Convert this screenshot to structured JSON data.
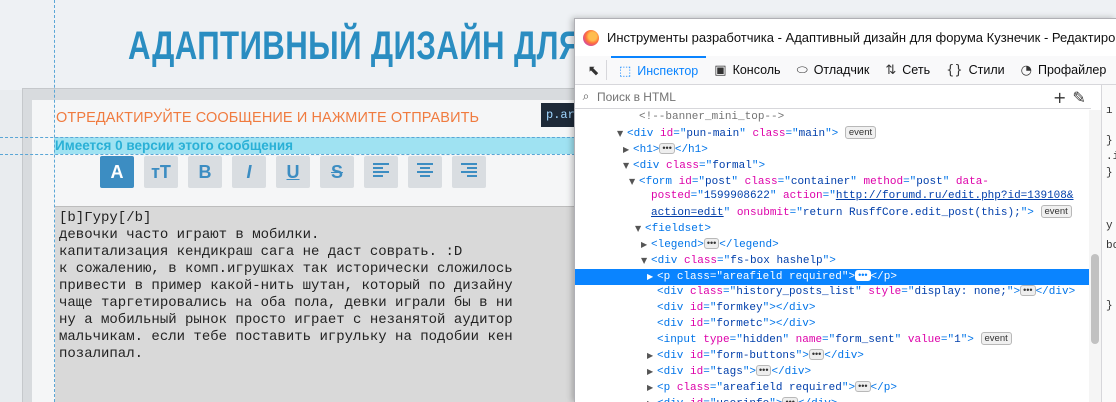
{
  "page": {
    "site_title": "АДАПТИВНЫЙ ДИЗАЙН ДЛЯ ФОРУМА",
    "edit_heading": "ОТРЕДАКТИРУЙТЕ СООБЩЕНИЕ И НАЖМИТЕ ОТПРАВИТЬ",
    "tooltip_chip": "p.areafield",
    "versions_text": "Имеется 0 версии этого сообщения",
    "toolbar": [
      {
        "name": "font-size-icon",
        "glyph": "A",
        "active": true
      },
      {
        "name": "text-case-icon",
        "glyph": "тT",
        "active": false
      },
      {
        "name": "bold-icon",
        "glyph": "B",
        "active": false
      },
      {
        "name": "italic-icon",
        "glyph": "I",
        "active": false
      },
      {
        "name": "underline-icon",
        "glyph": "U",
        "active": false
      },
      {
        "name": "strikethrough-icon",
        "glyph": "S",
        "active": false
      },
      {
        "name": "align-left-icon",
        "glyph": "",
        "active": false
      },
      {
        "name": "align-center-icon",
        "glyph": "",
        "active": false
      },
      {
        "name": "align-right-icon",
        "glyph": "",
        "active": false
      }
    ],
    "message_text": "[b]Гуру[/b]\nдевочки часто играют в мобилки.\nкапитализация кендикраш сага не даст соврать. :D\nк сожалению, в комп.игрушках так исторически сложилось\nпривести в пример какой-нить шутан, который по дизайну\nчаще таргетировались на оба пола, девки играли бы в ни\nну а мобильный рынок просто играет с незанятой аудитор\nмальчикам. если тебе поставить игрульку на подобии кен\nпозалипал."
  },
  "devtools": {
    "window_title": "Инструменты разработчика - Адаптивный дизайн для форума Кузнечик - Редактирование со",
    "tabs": [
      {
        "icon": "inspector-icon",
        "glyph": "⬚",
        "label": "Инспектор",
        "selected": true
      },
      {
        "icon": "console-icon",
        "glyph": "▣",
        "label": "Консоль",
        "selected": false
      },
      {
        "icon": "debugger-icon",
        "glyph": "⬭",
        "label": "Отладчик",
        "selected": false
      },
      {
        "icon": "network-icon",
        "glyph": "⇅",
        "label": "Сеть",
        "selected": false
      },
      {
        "icon": "style-editor-icon",
        "glyph": "{}",
        "label": "Стили",
        "selected": false
      },
      {
        "icon": "profiler-icon",
        "glyph": "◔",
        "label": "Профайлер",
        "selected": false
      }
    ],
    "search_placeholder": "Поиск в HTML",
    "side_pane_chars": [
      "ı",
      "}",
      ".i",
      "}",
      "у",
      "bo",
      "}"
    ],
    "selected_row": 9,
    "tree": [
      {
        "indent": 10,
        "tw": "",
        "parts": [
          [
            "cm",
            "<!--banner_mini_top-->"
          ]
        ]
      },
      {
        "indent": 8,
        "tw": "▼",
        "parts": [
          [
            "t",
            "<div "
          ],
          [
            "an",
            "id"
          ],
          [
            "t",
            "=\""
          ],
          [
            "av",
            "pun-main"
          ],
          [
            "t",
            "\" "
          ],
          [
            "an",
            "class"
          ],
          [
            "t",
            "=\""
          ],
          [
            "av",
            "main"
          ],
          [
            "t",
            "\">"
          ]
        ],
        "badge": "event"
      },
      {
        "indent": 9,
        "tw": "▶",
        "parts": [
          [
            "t",
            "<h1>"
          ]
        ],
        "ell": true,
        "after": [
          [
            "t",
            "</h1>"
          ]
        ]
      },
      {
        "indent": 9,
        "tw": "▼",
        "parts": [
          [
            "t",
            "<div "
          ],
          [
            "an",
            "class"
          ],
          [
            "t",
            "=\""
          ],
          [
            "av",
            "formal"
          ],
          [
            "t",
            "\">"
          ]
        ]
      },
      {
        "indent": 10,
        "tw": "▼",
        "parts": [
          [
            "t",
            "<form "
          ],
          [
            "an",
            "id"
          ],
          [
            "t",
            "=\""
          ],
          [
            "av",
            "post"
          ],
          [
            "t",
            "\" "
          ],
          [
            "an",
            "class"
          ],
          [
            "t",
            "=\""
          ],
          [
            "av",
            "container"
          ],
          [
            "t",
            "\" "
          ],
          [
            "an",
            "method"
          ],
          [
            "t",
            "=\""
          ],
          [
            "av",
            "post"
          ],
          [
            "t",
            "\" "
          ],
          [
            "an",
            "data-"
          ]
        ]
      },
      {
        "indent": 12,
        "tw": "",
        "parts": [
          [
            "an",
            "posted"
          ],
          [
            "t",
            "=\""
          ],
          [
            "av",
            "1599908622"
          ],
          [
            "t",
            "\" "
          ],
          [
            "an",
            "action"
          ],
          [
            "t",
            "=\""
          ],
          [
            "av link",
            "http://forumd.ru/edit.php?id=139108&"
          ]
        ]
      },
      {
        "indent": 12,
        "tw": "",
        "parts": [
          [
            "av link",
            "action=edit"
          ],
          [
            "t",
            "\" "
          ],
          [
            "an",
            "onsubmit"
          ],
          [
            "t",
            "=\""
          ],
          [
            "av",
            "return RusffCore.edit_post(this);"
          ],
          [
            "t",
            "\">"
          ]
        ],
        "badge": "event"
      },
      {
        "indent": 11,
        "tw": "▼",
        "parts": [
          [
            "t",
            "<fieldset>"
          ]
        ]
      },
      {
        "indent": 12,
        "tw": "▶",
        "parts": [
          [
            "t",
            "<legend>"
          ]
        ],
        "ell": true,
        "after": [
          [
            "t",
            "</legend>"
          ]
        ]
      },
      {
        "indent": 12,
        "tw": "▼",
        "parts": [
          [
            "t",
            "<div "
          ],
          [
            "an",
            "class"
          ],
          [
            "t",
            "=\""
          ],
          [
            "av",
            "fs-box hashelp"
          ],
          [
            "t",
            "\">"
          ]
        ]
      },
      {
        "indent": 13,
        "tw": "▶",
        "parts": [
          [
            "t",
            "<p "
          ],
          [
            "an",
            "class"
          ],
          [
            "t",
            "=\""
          ],
          [
            "av",
            "areafield required"
          ],
          [
            "t",
            "\">"
          ]
        ],
        "ell": true,
        "after": [
          [
            "t",
            "</p>"
          ]
        ]
      },
      {
        "indent": 13,
        "tw": "",
        "parts": [
          [
            "t",
            "<div "
          ],
          [
            "an",
            "class"
          ],
          [
            "t",
            "=\""
          ],
          [
            "av",
            "history_posts_list"
          ],
          [
            "t",
            "\" "
          ],
          [
            "an",
            "style"
          ],
          [
            "t",
            "=\""
          ],
          [
            "av",
            "display: none;"
          ],
          [
            "t",
            "\">"
          ]
        ],
        "ell": true,
        "after": [
          [
            "t",
            "</div>"
          ]
        ]
      },
      {
        "indent": 13,
        "tw": "",
        "parts": [
          [
            "t",
            "<div "
          ],
          [
            "an",
            "id"
          ],
          [
            "t",
            "=\""
          ],
          [
            "av",
            "formkey"
          ],
          [
            "t",
            "\"></div>"
          ]
        ]
      },
      {
        "indent": 13,
        "tw": "",
        "parts": [
          [
            "t",
            "<div "
          ],
          [
            "an",
            "id"
          ],
          [
            "t",
            "=\""
          ],
          [
            "av",
            "formetc"
          ],
          [
            "t",
            "\"></div>"
          ]
        ]
      },
      {
        "indent": 13,
        "tw": "",
        "parts": [
          [
            "t",
            "<input "
          ],
          [
            "an",
            "type"
          ],
          [
            "t",
            "=\""
          ],
          [
            "av",
            "hidden"
          ],
          [
            "t",
            "\" "
          ],
          [
            "an",
            "name"
          ],
          [
            "t",
            "=\""
          ],
          [
            "av",
            "form_sent"
          ],
          [
            "t",
            "\" "
          ],
          [
            "an",
            "value"
          ],
          [
            "t",
            "=\""
          ],
          [
            "av",
            "1"
          ],
          [
            "t",
            "\">"
          ]
        ],
        "badge": "event"
      },
      {
        "indent": 13,
        "tw": "▶",
        "parts": [
          [
            "t",
            "<div "
          ],
          [
            "an",
            "id"
          ],
          [
            "t",
            "=\""
          ],
          [
            "av",
            "form-buttons"
          ],
          [
            "t",
            "\">"
          ]
        ],
        "ell": true,
        "after": [
          [
            "t",
            "</div>"
          ]
        ]
      },
      {
        "indent": 13,
        "tw": "▶",
        "parts": [
          [
            "t",
            "<div "
          ],
          [
            "an",
            "id"
          ],
          [
            "t",
            "=\""
          ],
          [
            "av",
            "tags"
          ],
          [
            "t",
            "\">"
          ]
        ],
        "ell": true,
        "after": [
          [
            "t",
            "</div>"
          ]
        ]
      },
      {
        "indent": 13,
        "tw": "▶",
        "parts": [
          [
            "t",
            "<p "
          ],
          [
            "an",
            "class"
          ],
          [
            "t",
            "=\""
          ],
          [
            "av",
            "areafield required"
          ],
          [
            "t",
            "\">"
          ]
        ],
        "ell": true,
        "after": [
          [
            "t",
            "</p>"
          ]
        ]
      },
      {
        "indent": 13,
        "tw": "▶",
        "parts": [
          [
            "t",
            "<div "
          ],
          [
            "an",
            "id"
          ],
          [
            "t",
            "=\""
          ],
          [
            "av",
            "userinfo"
          ],
          [
            "t",
            "\">"
          ]
        ],
        "ell": true,
        "after": [
          [
            "t",
            "</div>"
          ]
        ]
      }
    ]
  },
  "colors": {
    "title_blue": "#2a8dc1",
    "heading_orange": "#f07b3f",
    "selection_blue": "#0a84ff"
  }
}
